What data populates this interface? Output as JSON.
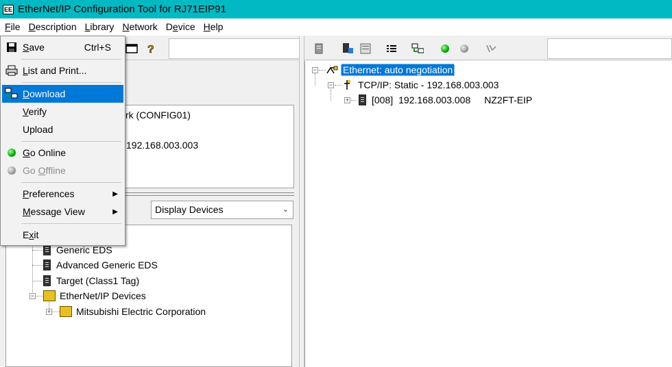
{
  "window": {
    "title": "EtherNet/IP Configuration Tool for RJ71EIP91",
    "app_icon": "EE"
  },
  "menubar": [
    {
      "label": "File",
      "key": "F",
      "rest": "ile"
    },
    {
      "label": "Description",
      "key": "D",
      "rest": "escription"
    },
    {
      "label": "Library",
      "key": "L",
      "rest": "ibrary"
    },
    {
      "label": "Network",
      "key": "N",
      "rest": "etwork"
    },
    {
      "label": "Device",
      "key": "e",
      "pre": "D",
      "rest": "vice"
    },
    {
      "label": "Help",
      "key": "H",
      "rest": "elp"
    }
  ],
  "file_menu": {
    "save": {
      "pre": "",
      "key": "S",
      "rest": "ave",
      "shortcut": "Ctrl+S"
    },
    "list_print": {
      "pre": "",
      "key": "L",
      "rest": "ist and Print..."
    },
    "download": {
      "pre": "",
      "key": "D",
      "rest": "ownload"
    },
    "verify": {
      "pre": "",
      "key": "V",
      "rest": "erify"
    },
    "upload": {
      "label": "Upload"
    },
    "go_online": {
      "pre": "",
      "key": "G",
      "rest": "o Online"
    },
    "go_offline": {
      "pre": "Go ",
      "key": "O",
      "rest": "ffline"
    },
    "preferences": {
      "pre": "",
      "key": "P",
      "rest": "references"
    },
    "message_view": {
      "pre": "",
      "key": "M",
      "rest": "essage View"
    },
    "exit": {
      "pre": "E",
      "key": "x",
      "rest": "it"
    }
  },
  "left_info": {
    "line1": "rk (CONFIG01)",
    "line2": "192.168.003.003"
  },
  "device_filter": {
    "selected": "Display Devices"
  },
  "device_tree": [
    {
      "label": "Generic EDS"
    },
    {
      "label": "Advanced Generic EDS"
    },
    {
      "label": "Target (Class1 Tag)"
    },
    {
      "label": "EtherNet/IP Devices"
    },
    {
      "label": "Mitsubishi Electric Corporation"
    }
  ],
  "network_tree": {
    "root": "Ethernet: auto negotiation",
    "tcp": "TCP/IP: Static - 192.168.003.003",
    "device": {
      "slot": "[008]",
      "ip": "192.168.003.008",
      "model": "NZ2FT-EIP"
    }
  }
}
